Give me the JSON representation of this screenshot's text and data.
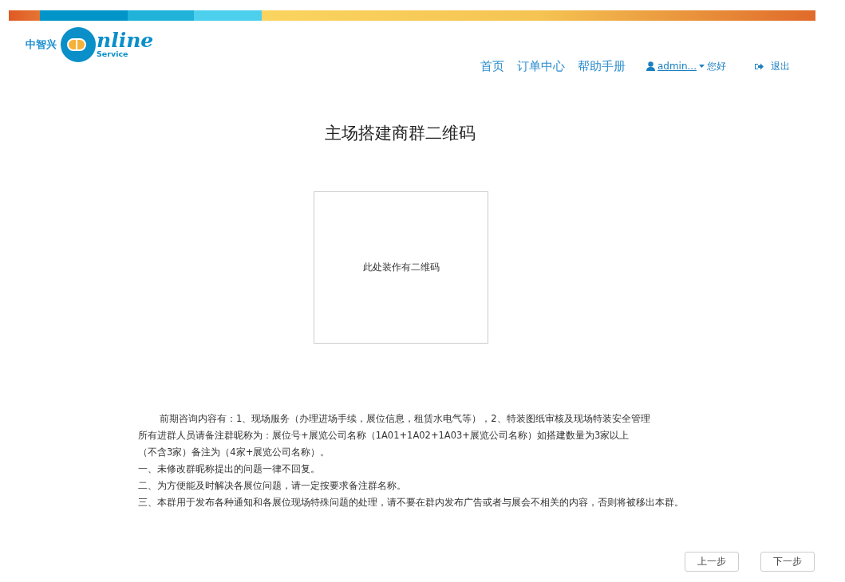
{
  "logo": {
    "brand": "中智兴",
    "word": "nline",
    "tagline": "Service"
  },
  "nav": [
    "首页",
    "订单中心",
    "帮助手册"
  ],
  "user": {
    "name": "admin...",
    "greeting": "您好"
  },
  "logout": "退出",
  "title": "主场搭建商群二维码",
  "qr_placeholder": "此处装作有二维码",
  "notes": [
    {
      "kind": "indent",
      "text": "前期咨询内容有：1、现场服务（办理进场手续，展位信息，租赁水电气等），2、特装图纸审核及现场特装安全管理"
    },
    {
      "kind": "plain",
      "text": "所有进群人员请备注群昵称为：展位号+展览公司名称（1A01+1A02+1A03+展览公司名称）如搭建数量为3家以上"
    },
    {
      "kind": "plain",
      "text": "（不含3家）备注为（4家+展览公司名称）。"
    },
    {
      "kind": "plain",
      "text": "一、未修改群昵称提出的问题一律不回复。"
    },
    {
      "kind": "plain",
      "text": "二、为方便能及时解决各展位问题，请一定按要求备注群名称。"
    },
    {
      "kind": "plain",
      "text": "三、本群用于发布各种通知和各展位现场特殊问题的处理，请不要在群内发布广告或者与展会不相关的内容，否则将被移出本群。"
    }
  ],
  "buttons": [
    "上一步",
    "下一步"
  ]
}
